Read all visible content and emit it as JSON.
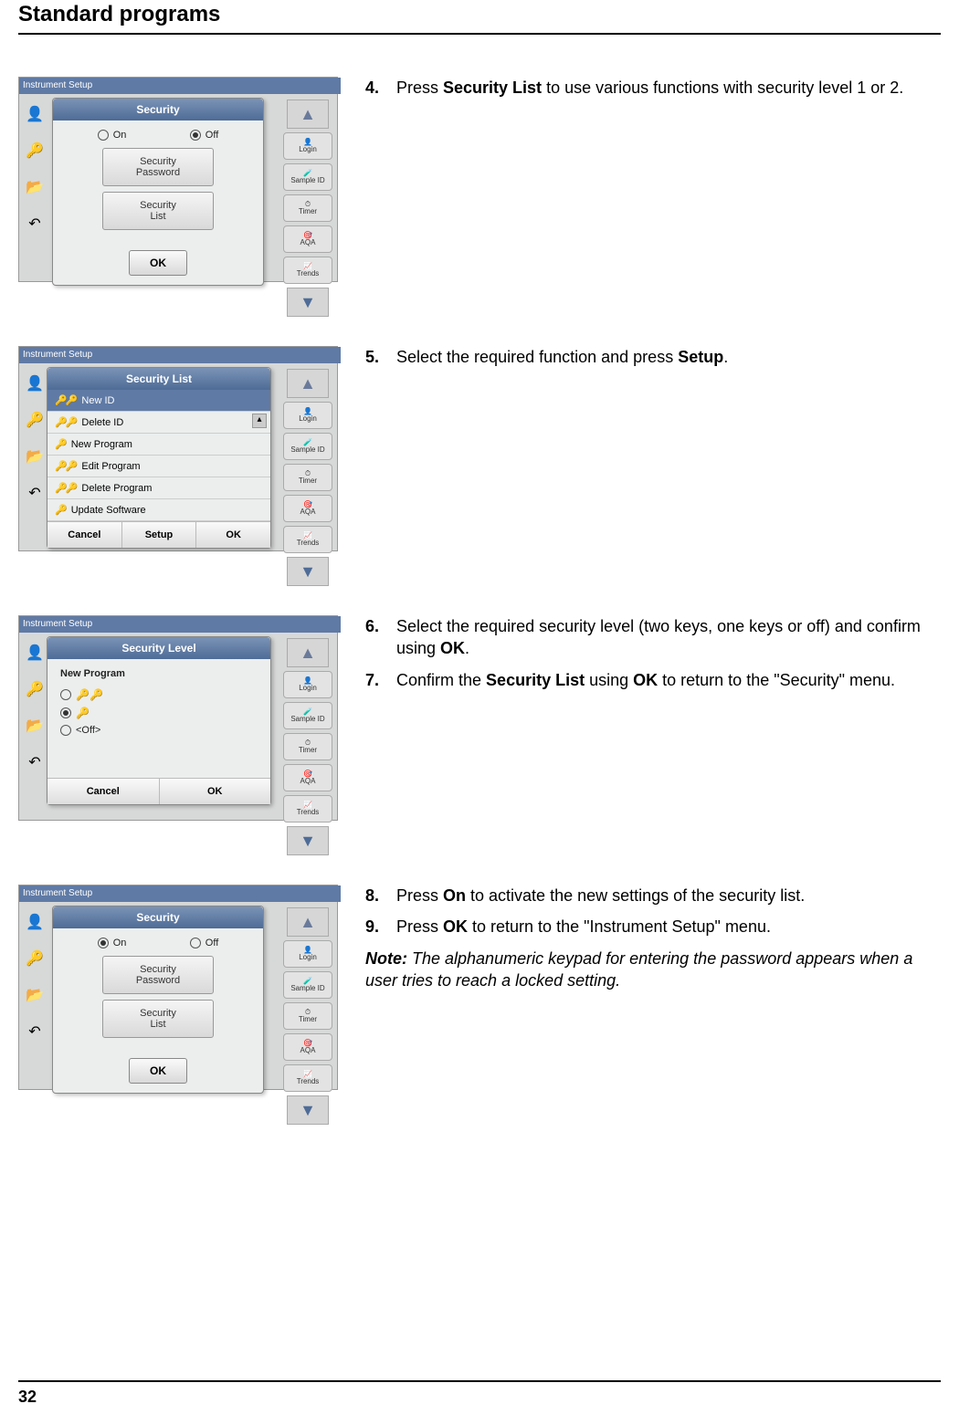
{
  "header": "Standard programs",
  "pageNumber": "32",
  "sidebar_labels": [
    "Login",
    "Sample ID",
    "Timer",
    "AQA",
    "Trends"
  ],
  "bgTitle": "Instrument Setup",
  "sec4": {
    "num": "4.",
    "pre": "Press ",
    "bold": "Security List",
    "post": " to use various functions with security level 1 or 2.",
    "dialog_title": "Security",
    "on": "On",
    "off": "Off",
    "btn1a": "Security",
    "btn1b": "Password",
    "btn2a": "Security",
    "btn2b": "List",
    "ok": "OK"
  },
  "sec5": {
    "num": "5.",
    "pre": "Select the required function and press ",
    "bold": "Setup",
    "post": ".",
    "dialog_title": "Security List",
    "items": [
      "New ID",
      "Delete ID",
      "New Program",
      "Edit Program",
      "Delete Program",
      "Update Software"
    ],
    "cancel": "Cancel",
    "setup": "Setup",
    "ok": "OK"
  },
  "sec67": {
    "num6": "6.",
    "t6a": "Select the required security level (two keys, one keys or off) and confirm using ",
    "t6b": "OK",
    "t6c": ".",
    "num7": "7.",
    "t7a": "Confirm the ",
    "t7b": "Security List",
    "t7c": " using ",
    "t7d": "OK",
    "t7e": " to return to the \"Security\" menu.",
    "dialog_title": "Security Level",
    "caption": "New Program",
    "off": "<Off>",
    "cancel": "Cancel",
    "ok": "OK"
  },
  "sec89": {
    "num8": "8.",
    "t8a": "Press ",
    "t8b": "On",
    "t8c": " to activate the new settings of the security list.",
    "num9": "9.",
    "t9a": "Press ",
    "t9b": "OK",
    "t9c": " to return to the \"Instrument Setup\" menu.",
    "noteLabel": "Note:",
    "note": " The alphanumeric keypad for entering the password appears when a user tries to reach a locked setting.",
    "dialog_title": "Security",
    "on": "On",
    "off": "Off",
    "btn1a": "Security",
    "btn1b": "Password",
    "btn2a": "Security",
    "btn2b": "List",
    "ok": "OK"
  }
}
